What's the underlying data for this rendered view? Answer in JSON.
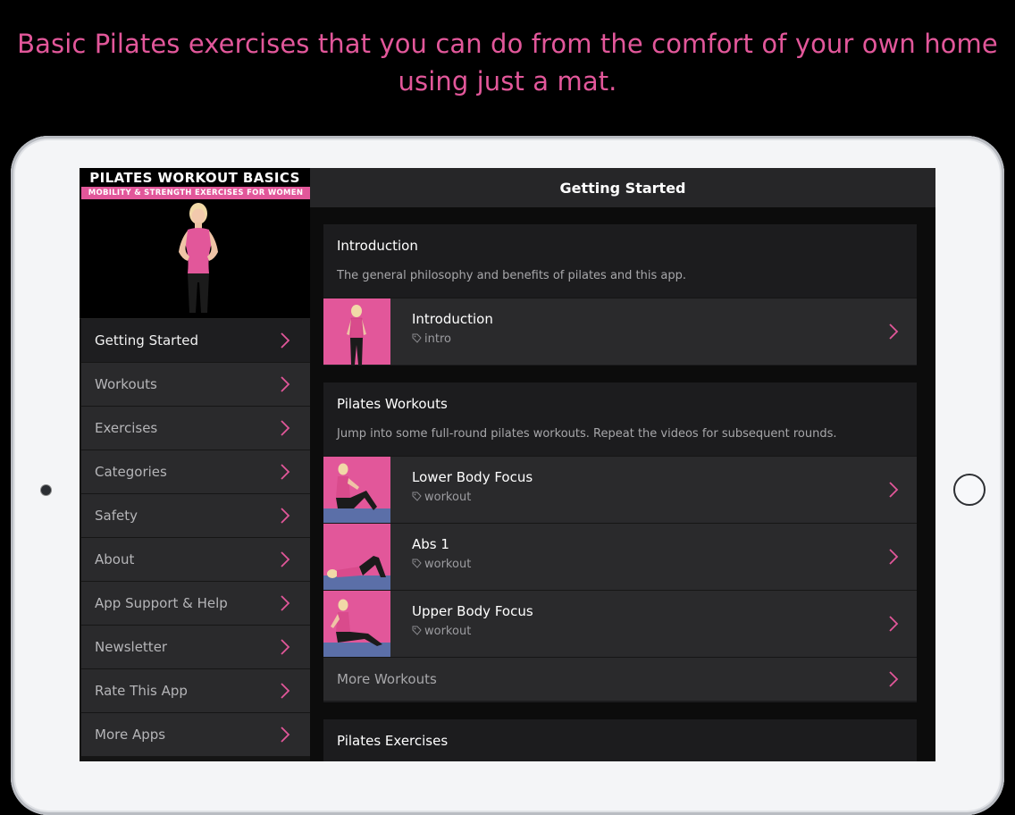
{
  "headline": {
    "line1": "Basic Pilates exercises that you can do from the comfort of your own home",
    "line2": "using just a mat."
  },
  "brand": {
    "title": "PILATES WORKOUT BASICS",
    "subtitle": "MOBILITY & STRENGTH EXERCISES FOR WOMEN"
  },
  "colors": {
    "accent": "#e2579a",
    "background": "#000000",
    "panel": "#2a2a2c"
  },
  "sidebar": {
    "items": [
      {
        "label": "Getting Started",
        "active": true
      },
      {
        "label": "Workouts"
      },
      {
        "label": "Exercises"
      },
      {
        "label": "Categories"
      },
      {
        "label": "Safety"
      },
      {
        "label": "About"
      },
      {
        "label": "App Support & Help"
      },
      {
        "label": "Newsletter"
      },
      {
        "label": "Rate This App"
      },
      {
        "label": "More Apps"
      }
    ]
  },
  "main": {
    "header_title": "Getting Started",
    "intro_section": {
      "title": "Introduction",
      "description": "The general philosophy and benefits of pilates and this app.",
      "items": [
        {
          "title": "Introduction",
          "tag": "intro",
          "icon": "tag-icon"
        }
      ]
    },
    "workouts_section": {
      "title": "Pilates Workouts",
      "description": "Jump into some full-round pilates workouts. Repeat the videos for subsequent rounds.",
      "items": [
        {
          "title": "Lower Body Focus",
          "tag": "workout",
          "icon": "tag-icon"
        },
        {
          "title": "Abs 1",
          "tag": "workout",
          "icon": "tag-icon"
        },
        {
          "title": "Upper Body Focus",
          "tag": "workout",
          "icon": "tag-icon"
        }
      ],
      "more_label": "More Workouts"
    },
    "exercises_section": {
      "title": "Pilates Exercises"
    }
  }
}
